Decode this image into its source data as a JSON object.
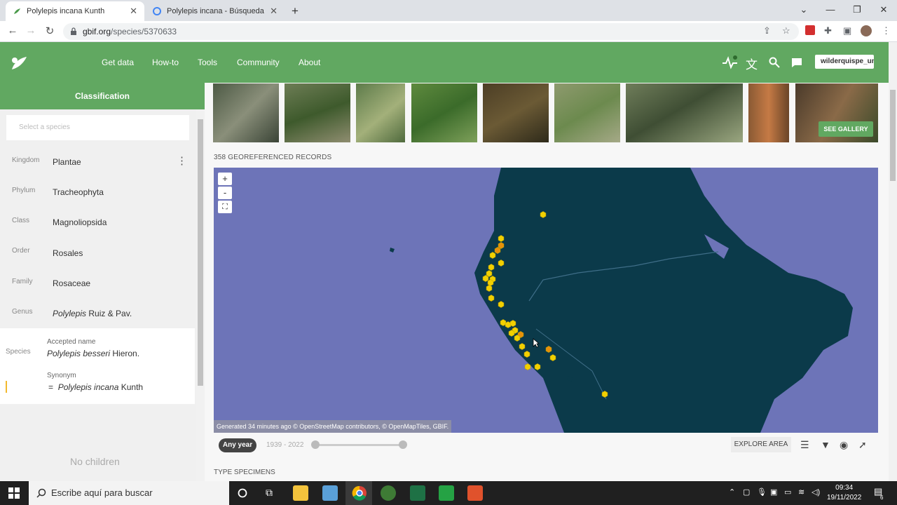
{
  "browser": {
    "tabs": [
      {
        "title": "Polylepis incana Kunth",
        "active": true
      },
      {
        "title": "Polylepis incana - Búsqueda de Google",
        "active": false
      }
    ],
    "new_tab": "+",
    "url_host": "gbif.org",
    "url_path": "/species/5370633",
    "window_controls": [
      "⌄",
      "—",
      "❐",
      "✕"
    ]
  },
  "gbif_nav": {
    "links": [
      "Get data",
      "How-to",
      "Tools",
      "Community",
      "About"
    ],
    "user": "wilderquispe_und"
  },
  "sidebar": {
    "header": "Classification",
    "search_placeholder": "Select a species",
    "ranks": [
      {
        "rank": "Kingdom",
        "value": "Plantae"
      },
      {
        "rank": "Phylum",
        "value": "Tracheophyta"
      },
      {
        "rank": "Class",
        "value": "Magnoliopsida"
      },
      {
        "rank": "Order",
        "value": "Rosales"
      },
      {
        "rank": "Family",
        "value": "Rosaceae"
      },
      {
        "rank": "Genus",
        "value_italic": "Polylepis",
        "value_rest": " Ruiz & Pav."
      }
    ],
    "species_label": "Species",
    "accepted_label": "Accepted name",
    "accepted_italic": "Polylepis besseri",
    "accepted_rest": " Hieron.",
    "synonym_label": "Synonym",
    "synonym_eq": "=",
    "synonym_italic": "Polylepis incana",
    "synonym_rest": " Kunth",
    "no_children": "No children"
  },
  "main": {
    "see_gallery": "SEE GALLERY",
    "georef_count": "358 GEOREFERENCED RECORDS",
    "map_attribution": "Generated 34 minutes ago © OpenStreetMap contributors, © OpenMapTiles, GBIF.",
    "zoom_in": "+",
    "zoom_out": "-",
    "fullscreen": "⛶",
    "any_year": "Any year",
    "year_range": "1939 - 2022",
    "explore_area": "EXPLORE AREA",
    "type_specimens": "TYPE SPECIMENS"
  },
  "taskbar": {
    "search_placeholder": "Escribe aquí para buscar",
    "time": "09:34",
    "date": "19/11/2022",
    "notifications": "6"
  },
  "colors": {
    "gbif_green": "#61a861",
    "ocean": "#6d74b8",
    "land": "#0b3a4a",
    "dot_yellow": "#f2d000",
    "dot_orange": "#e8900a"
  }
}
